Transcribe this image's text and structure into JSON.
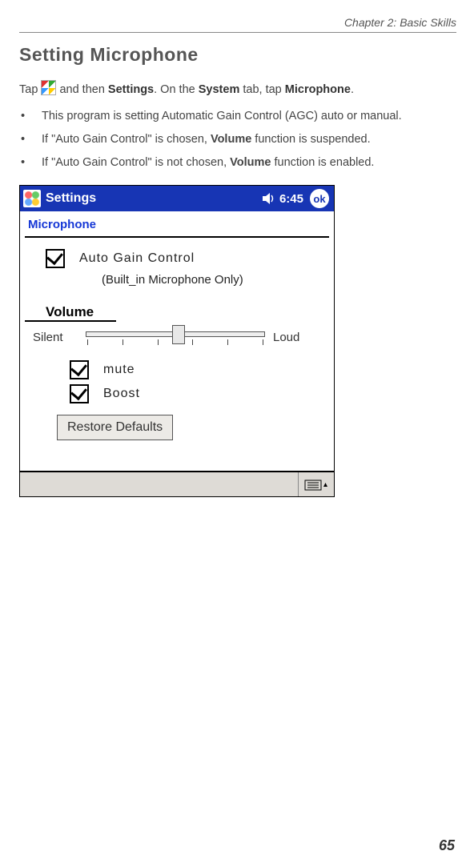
{
  "header": {
    "chapter": "Chapter 2: Basic Skills"
  },
  "heading": "Setting Microphone",
  "intro": {
    "pre": "Tap ",
    "mid1": " and then ",
    "b1": "Settings",
    "mid2": ". On the ",
    "b2": "System",
    "mid3": " tab, tap ",
    "b3": "Microphone",
    "post": "."
  },
  "bullets": [
    {
      "text": "This program is setting Automatic Gain Control (AGC) auto or manual."
    },
    {
      "pre": "If \"Auto Gain Control\" is chosen, ",
      "b": "Volume",
      "post": " function is suspended."
    },
    {
      "pre": "If \"Auto Gain Control\" is not chosen, ",
      "b": "Volume",
      "post": " function is enabled."
    }
  ],
  "device": {
    "titlebar": {
      "title": "Settings",
      "clock": "6:45",
      "ok": "ok"
    },
    "screen_title": "Microphone",
    "agc": {
      "checked": true,
      "label": "Auto Gain Control",
      "sub": "(Built_in Microphone Only)"
    },
    "volume": {
      "header": "Volume",
      "min_label": "Silent",
      "max_label": "Loud",
      "mute": {
        "checked": true,
        "label": "mute"
      },
      "boost": {
        "checked": true,
        "label": "Boost"
      },
      "restore": "Restore Defaults"
    }
  },
  "page_number": "65"
}
